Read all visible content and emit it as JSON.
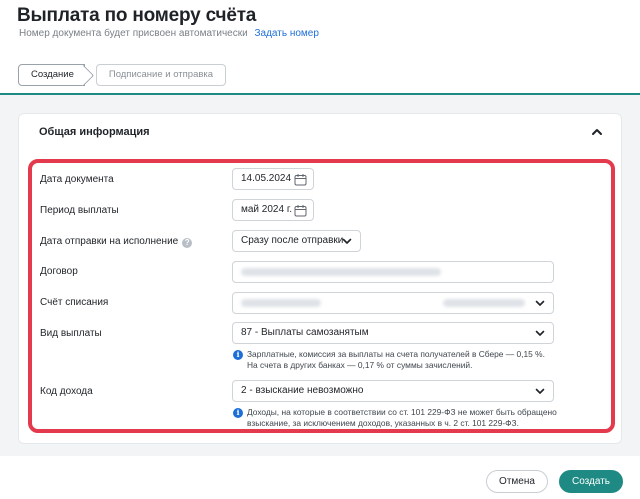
{
  "header": {
    "title": "Выплата по номеру счёта",
    "subtitle": "Номер документа будет присвоен автоматически",
    "set_number_link": "Задать номер"
  },
  "tabs": [
    {
      "label": "Создание",
      "active": true
    },
    {
      "label": "Подписание и отправка",
      "active": false
    }
  ],
  "section": {
    "title": "Общая информация",
    "expanded": true
  },
  "form": {
    "document_date": {
      "label": "Дата документа",
      "value": "14.05.2024"
    },
    "payment_period": {
      "label": "Период выплаты",
      "value": "май 2024 г."
    },
    "send_date": {
      "label": "Дата отправки на исполнение",
      "value": "Сразу после отправки"
    },
    "contract": {
      "label": "Договор"
    },
    "debit_account": {
      "label": "Счёт списания"
    },
    "payment_type": {
      "label": "Вид выплаты",
      "value": "87 - Выплаты самозанятым",
      "hint_line1": "Зарплатные, комиссия за выплаты на счета получателей в Сбере — 0,15 %.",
      "hint_line2": "На счета в других банках — 0,17 % от суммы зачислений."
    },
    "income_code": {
      "label": "Код дохода",
      "value": "2 - взыскание невозможно",
      "hint_line1": "Доходы, на которые в соответствии со ст. 101 229-ФЗ не может быть обращено",
      "hint_line2": "взыскание, за исключением доходов, указанных в ч. 2 ст. 101 229-ФЗ."
    }
  },
  "buttons": {
    "cancel": "Отмена",
    "create": "Создать"
  },
  "colors": {
    "accent": "#1e8a83",
    "link": "#1d6fd8",
    "highlight": "#e43a4d"
  }
}
